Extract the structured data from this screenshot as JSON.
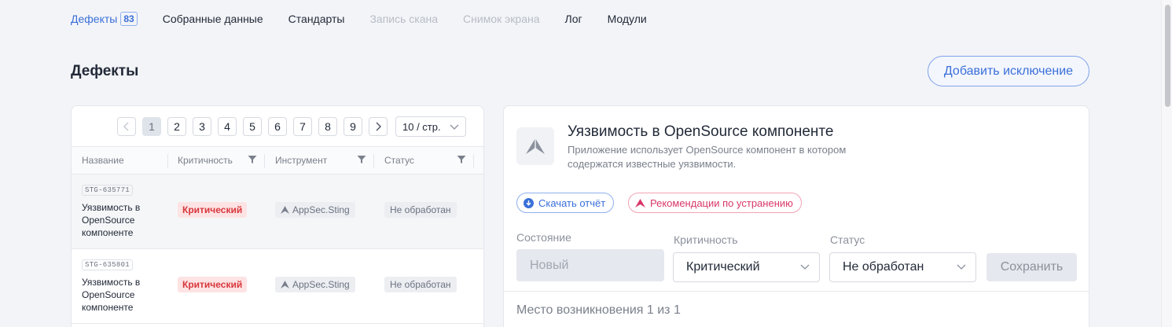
{
  "nav": {
    "tabs": [
      {
        "label": "Дефекты",
        "badge": "83"
      },
      {
        "label": "Собранные данные"
      },
      {
        "label": "Стандарты"
      },
      {
        "label": "Запись скана"
      },
      {
        "label": "Снимок экрана"
      },
      {
        "label": "Лог"
      },
      {
        "label": "Модули"
      }
    ]
  },
  "page": {
    "title": "Дефекты",
    "add_exception_label": "Добавить исключение"
  },
  "pagination": {
    "pages": [
      "1",
      "2",
      "3",
      "4",
      "5",
      "6",
      "7",
      "8",
      "9"
    ],
    "current": "1",
    "per_page": "10 / стр."
  },
  "table": {
    "columns": [
      "Название",
      "Критичность",
      "Инструмент",
      "Статус"
    ],
    "rows": [
      {
        "code": "STG-635771",
        "name": "Уязвимость в OpenSource компоненте",
        "criticality": "Критический",
        "tool": "AppSec.Sting",
        "status": "Не обработан"
      },
      {
        "code": "STG-635801",
        "name": "Уязвимость в OpenSource компоненте",
        "criticality": "Критический",
        "tool": "AppSec.Sting",
        "status": "Не обработан"
      }
    ]
  },
  "detail": {
    "title": "Уязвимость в OpenSource компоненте",
    "description": "Приложение использует OpenSource компонент в котором содержатся известные уязвимости.",
    "download_label": "Скачать отчёт",
    "recommendations_label": "Рекомендации по устранению",
    "state_label": "Состояние",
    "state_value": "Новый",
    "criticality_label": "Критичность",
    "criticality_value": "Критический",
    "status_label": "Статус",
    "status_value": "Не обработан",
    "save_label": "Сохранить",
    "occurrence_label": "Место возникновения 1 из 1"
  },
  "colors": {
    "accent": "#3a6fd8",
    "critical": "#d8373d",
    "recommend": "#d8376a"
  }
}
